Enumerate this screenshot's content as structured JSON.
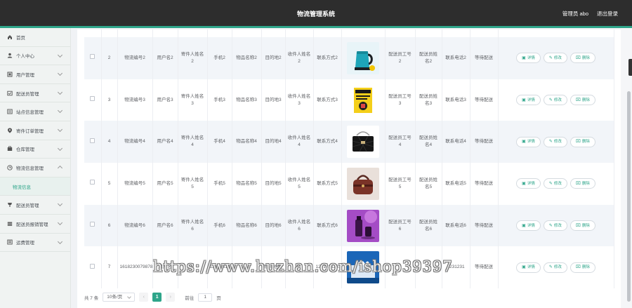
{
  "header": {
    "title": "物流管理系统",
    "user": "管理员 abo",
    "logout": "退出登录"
  },
  "sidebar": {
    "items": [
      {
        "label": "首页",
        "icon": "home-icon"
      },
      {
        "label": "个人中心",
        "icon": "user-icon"
      },
      {
        "label": "用户管理",
        "icon": "users-icon"
      },
      {
        "label": "配送员管理",
        "icon": "courier-icon"
      },
      {
        "label": "站点信息管理",
        "icon": "station-icon"
      },
      {
        "label": "寄件订单管理",
        "icon": "order-icon"
      },
      {
        "label": "仓库管理",
        "icon": "warehouse-icon"
      },
      {
        "label": "物流信息管理",
        "icon": "logistics-icon"
      },
      {
        "label": "物流信息",
        "icon": ""
      },
      {
        "label": "配送员管理",
        "icon": "delivery-icon"
      },
      {
        "label": "配送员报销管理",
        "icon": "reimburse-icon"
      },
      {
        "label": "运费管理",
        "icon": "freight-icon"
      }
    ]
  },
  "table": {
    "rows": [
      {
        "no": "2",
        "code": "物流编号2",
        "user": "用户名2",
        "sender": "寄件人姓名2",
        "phone": "手机2",
        "item": "物品名称2",
        "dest": "目的地2",
        "receiver": "收件人姓名2",
        "contact": "联系方式2",
        "img": "kettle",
        "staff_no": "配送员工号2",
        "staff_name": "配送员姓名2",
        "staff_phone": "联系电话2",
        "status": "等待配送"
      },
      {
        "no": "3",
        "code": "物流编号3",
        "user": "用户名3",
        "sender": "寄件人姓名3",
        "phone": "手机3",
        "item": "物品名称3",
        "dest": "目的地3",
        "receiver": "收件人姓名3",
        "contact": "联系方式3",
        "img": "book",
        "staff_no": "配送员工号3",
        "staff_name": "配送员姓名3",
        "staff_phone": "联系电话3",
        "status": "等待配送"
      },
      {
        "no": "4",
        "code": "物流编号4",
        "user": "用户名4",
        "sender": "寄件人姓名4",
        "phone": "手机4",
        "item": "物品名称4",
        "dest": "目的地4",
        "receiver": "收件人姓名4",
        "contact": "联系方式4",
        "img": "bag-black",
        "staff_no": "配送员工号4",
        "staff_name": "配送员姓名4",
        "staff_phone": "联系电话4",
        "status": "等待配送"
      },
      {
        "no": "5",
        "code": "物流编号5",
        "user": "用户名5",
        "sender": "寄件人姓名5",
        "phone": "手机5",
        "item": "物品名称5",
        "dest": "目的地5",
        "receiver": "收件人姓名5",
        "contact": "联系方式5",
        "img": "bag-brown",
        "staff_no": "配送员工号5",
        "staff_name": "配送员姓名5",
        "staff_phone": "联系电话5",
        "status": "等待配送"
      },
      {
        "no": "6",
        "code": "物流编号6",
        "user": "用户名6",
        "sender": "寄件人姓名6",
        "phone": "手机6",
        "item": "物品名称6",
        "dest": "目的地6",
        "receiver": "收件人姓名6",
        "contact": "联系方式6",
        "img": "cosmetics",
        "staff_no": "配送员工号6",
        "staff_name": "配送员姓名6",
        "staff_phone": "联系电话6",
        "status": "等待配送"
      },
      {
        "no": "7",
        "code": "1618230079878",
        "user": "用户名",
        "sender": "",
        "phone": "1231231231",
        "item": "",
        "dest": "物流地址",
        "receiver": "",
        "contact": "1231231231",
        "img": "tissue",
        "staff_no": "",
        "staff_name": "",
        "staff_phone": "1231231",
        "status": "等待配送"
      }
    ],
    "actions": {
      "detail": "详情",
      "edit": "修改",
      "delete": "删除"
    }
  },
  "pagination": {
    "total": "共 7 条",
    "page_size": "10条/页",
    "prev": "‹",
    "current": "1",
    "next": "›",
    "goto_label": "前往",
    "goto_value": "1",
    "page_suffix": "页"
  },
  "watermark": "https://www.huzhan.com/ishop39397"
}
